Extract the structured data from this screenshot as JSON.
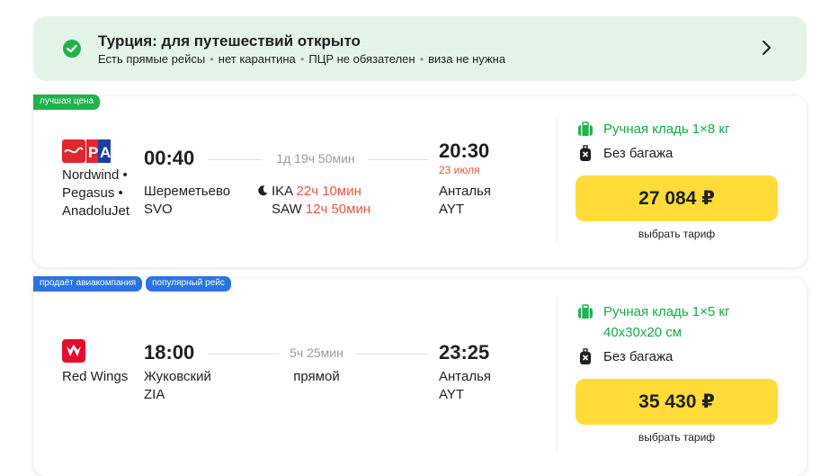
{
  "banner": {
    "title": "Турция: для путешествий открыто",
    "items": [
      "Есть прямые рейсы",
      "нет карантина",
      "ПЦР не обязателен",
      "виза не нужна"
    ],
    "separator": "•",
    "accent_color": "#22b24c",
    "background_color": "#e4f5e7",
    "icons": {
      "status": "check-circle-icon",
      "arrow": "chevron-right-icon"
    }
  },
  "flights": [
    {
      "badges": [
        "лучшая цена"
      ],
      "airlines": [
        "Nordwind •",
        "Pegasus •",
        "AnadoluJet"
      ],
      "departure": {
        "time": "00:40",
        "city": "Шереметьево",
        "code": "SVO"
      },
      "duration": "1д 19ч 50мин",
      "transfers": [
        {
          "code": "IKA",
          "wait": "22ч 10мин",
          "night": true
        },
        {
          "code": "SAW",
          "wait": "12ч 50мин",
          "night": false
        }
      ],
      "arrival": {
        "time": "20:30",
        "date_note": "23 июля",
        "city": "Анталья",
        "code": "AYT"
      },
      "baggage": {
        "hand": "Ручная кладь 1×8 кг",
        "hand_size": "",
        "checked": "Без багажа"
      },
      "price": "27 084 ₽",
      "tariff_label": "выбрать тариф"
    },
    {
      "badges": [
        "продаёт авиакомпания",
        "популярный рейс"
      ],
      "airlines": [
        "Red Wings"
      ],
      "departure": {
        "time": "18:00",
        "city": "Жуковский",
        "code": "ZIA"
      },
      "duration": "5ч 25мин",
      "direct_label": "прямой",
      "arrival": {
        "time": "23:25",
        "city": "Анталья",
        "code": "AYT"
      },
      "baggage": {
        "hand": "Ручная кладь 1×5 кг",
        "hand_size": "40x30x20 см",
        "checked": "Без багажа"
      },
      "price": "35 430 ₽",
      "tariff_label": "выбрать тариф"
    }
  ],
  "colors": {
    "price_button": "#ffdc37",
    "warning": "#e8553f",
    "baggage_ok": "#16a845",
    "badge_blue": "#2a74e0"
  }
}
